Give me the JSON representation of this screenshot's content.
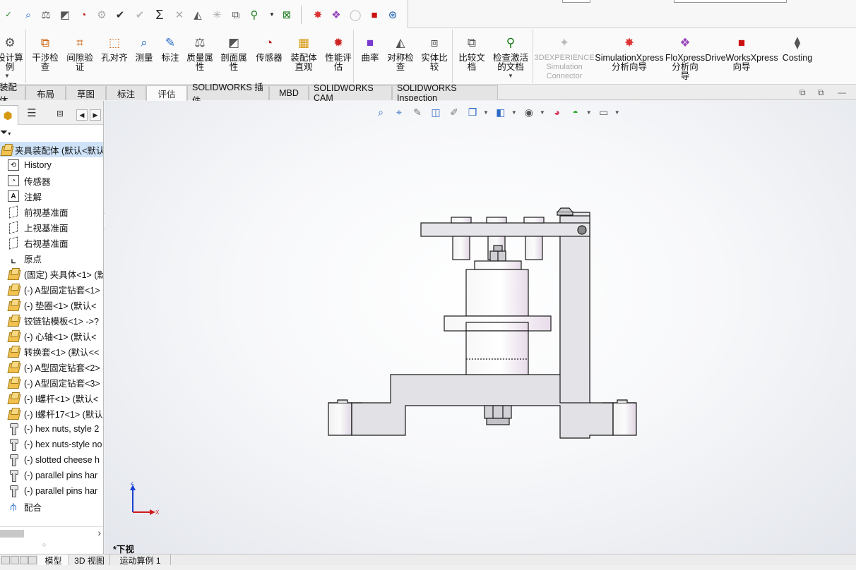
{
  "ribbon": {
    "buttons": [
      {
        "name": "design-check",
        "label": "设计算\n例",
        "icon": "calculator-icon"
      },
      {
        "name": "interference-check",
        "label": "干涉检\n查",
        "icon": "interference-icon"
      },
      {
        "name": "clearance-verify",
        "label": "间隙验\n证",
        "icon": "clearance-icon"
      },
      {
        "name": "hole-alignment",
        "label": "孔对齐",
        "icon": "hole-align-icon"
      },
      {
        "name": "measure",
        "label": "测量",
        "icon": "measure-icon"
      },
      {
        "name": "markup",
        "label": "标注",
        "icon": "markup-icon"
      },
      {
        "name": "mass-properties",
        "label": "质量属\n性",
        "icon": "scale-icon"
      },
      {
        "name": "section-properties",
        "label": "剖面属\n性",
        "icon": "section-icon"
      },
      {
        "name": "sensor",
        "label": "传感器",
        "icon": "gauge-icon"
      },
      {
        "name": "assembly-visualization",
        "label": "装配体\n直观",
        "icon": "assembly-vis-icon"
      },
      {
        "name": "performance-evaluation",
        "label": "性能评\n估",
        "icon": "performance-icon"
      },
      {
        "name": "curvature",
        "label": "曲率",
        "icon": "curvature-icon"
      },
      {
        "name": "symmetry-check",
        "label": "对称检\n查",
        "icon": "symmetry-icon"
      },
      {
        "name": "compare-bodies",
        "label": "实体比\n较",
        "icon": "compare-bodies-icon"
      },
      {
        "name": "compare-documents",
        "label": "比较文\n档",
        "icon": "compare-docs-icon"
      },
      {
        "name": "check-active-document",
        "label": "检查激活\n的文档",
        "icon": "check-doc-icon"
      },
      {
        "name": "3dexperience-connector",
        "label": "3DEXPERIENCE\nSimulation\nConnector",
        "icon": "3dx-icon"
      },
      {
        "name": "simulationxpress",
        "label": "SimulationXpress\n分析向导",
        "icon": "simxpress-icon"
      },
      {
        "name": "floxpress",
        "label": "FloXpress\n分析向\n导",
        "icon": "floxpress-icon"
      },
      {
        "name": "driveworksxpress",
        "label": "DriveWorksXpress\n向导",
        "icon": "driveworks-icon"
      },
      {
        "name": "costing",
        "label": "Costing",
        "icon": "costing-icon"
      }
    ]
  },
  "tabs": {
    "items": [
      "装配体",
      "布局",
      "草图",
      "标注",
      "评估",
      "SOLIDWORKS 插件",
      "MBD",
      "SOLIDWORKS CAM",
      "SOLIDWORKS Inspection"
    ],
    "active": "评估"
  },
  "tree": {
    "root": "夹具装配体 (默认<默认_",
    "items": [
      {
        "label": "History",
        "icon": "history-icon"
      },
      {
        "label": "传感器",
        "icon": "sensor-icon"
      },
      {
        "label": "注解",
        "icon": "annotation-icon"
      },
      {
        "label": "前视基准面",
        "icon": "plane-icon"
      },
      {
        "label": "上视基准面",
        "icon": "plane-icon"
      },
      {
        "label": "右视基准面",
        "icon": "plane-icon"
      },
      {
        "label": "原点",
        "icon": "origin-icon"
      },
      {
        "label": "(固定) 夹具体<1> (默",
        "icon": "part-icon"
      },
      {
        "label": "(-) A型固定钻套<1>",
        "icon": "part-icon"
      },
      {
        "label": "(-) 垫圈<1> (默认<",
        "icon": "part-icon"
      },
      {
        "label": "铰链钻模板<1> ->?",
        "icon": "part-icon"
      },
      {
        "label": "(-) 心轴<1> (默认<",
        "icon": "part-icon"
      },
      {
        "label": "转换套<1> (默认<<",
        "icon": "part-icon"
      },
      {
        "label": "(-) A型固定钻套<2>",
        "icon": "part-icon"
      },
      {
        "label": "(-) A型固定钻套<3>",
        "icon": "part-icon"
      },
      {
        "label": "(-) l螺杆<1> (默认<",
        "icon": "part-icon"
      },
      {
        "label": "(-) l螺杆17<1> (默认",
        "icon": "part-icon"
      },
      {
        "label": "(-) hex nuts, style 2",
        "icon": "toolbox-icon"
      },
      {
        "label": "(-) hex nuts-style no",
        "icon": "toolbox-icon"
      },
      {
        "label": "(-) slotted cheese h",
        "icon": "toolbox-icon"
      },
      {
        "label": "(-) parallel pins har",
        "icon": "toolbox-icon"
      },
      {
        "label": "(-) parallel pins har",
        "icon": "toolbox-icon"
      },
      {
        "label": "配合",
        "icon": "mates-icon"
      }
    ]
  },
  "viewport": {
    "view_label": "*下视",
    "triad": {
      "z": "Z",
      "x": "X"
    }
  },
  "bottom_tabs": {
    "items": [
      "模型",
      "3D 视图",
      "运动算例 1"
    ],
    "active": "模型"
  },
  "colors": {
    "accent": "#1e6fd9",
    "selection": "#cfe3f8",
    "part_fill": "#e3e3e6",
    "bushing_tint": "#e8dcea"
  }
}
